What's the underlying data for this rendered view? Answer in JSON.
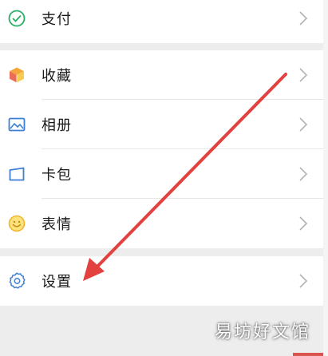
{
  "menu": {
    "items": [
      {
        "label": "支付",
        "icon": "payment-icon"
      },
      {
        "label": "收藏",
        "icon": "favorites-icon"
      },
      {
        "label": "相册",
        "icon": "album-icon"
      },
      {
        "label": "卡包",
        "icon": "card-wallet-icon"
      },
      {
        "label": "表情",
        "icon": "sticker-icon"
      },
      {
        "label": "设置",
        "icon": "settings-icon"
      }
    ]
  },
  "watermark": {
    "text": "易坊好文馆"
  },
  "colors": {
    "payment_green": "#2aae67",
    "settings_blue": "#3f7fd3",
    "arrow_red": "#e2413f",
    "background": "#ededed"
  }
}
